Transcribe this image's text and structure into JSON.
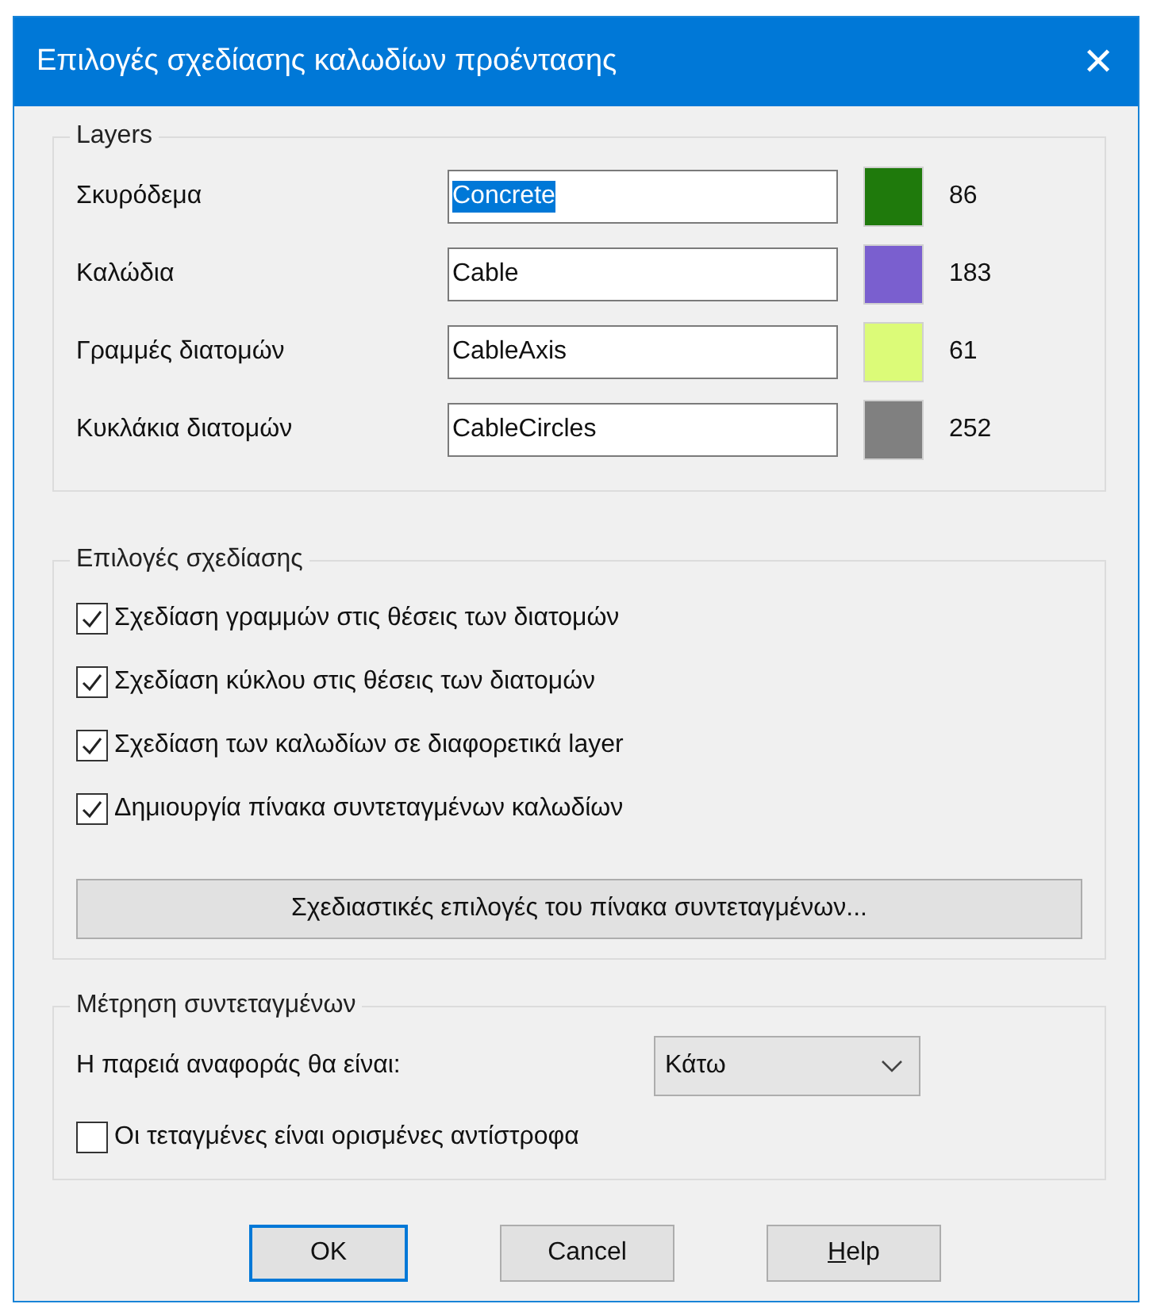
{
  "window": {
    "title": "Επιλογές σχεδίασης καλωδίων προέντασης",
    "close": "✕"
  },
  "layers": {
    "title": "Layers",
    "rows": [
      {
        "label": "Σκυρόδεμα",
        "value": "Concrete",
        "selected": true,
        "color": "#1f7a0c",
        "number": "86"
      },
      {
        "label": "Καλώδια",
        "value": "Cable",
        "selected": false,
        "color": "#7a5fcf",
        "number": "183"
      },
      {
        "label": "Γραμμές διατομών",
        "value": "CableAxis",
        "selected": false,
        "color": "#dcfb78",
        "number": "61"
      },
      {
        "label": "Κυκλάκια διατομών",
        "value": "CableCircles",
        "selected": false,
        "color": "#808080",
        "number": "252"
      }
    ]
  },
  "drawing_options": {
    "title": "Επιλογές σχεδίασης",
    "checkboxes": [
      {
        "label": "Σχεδίαση γραμμών στις θέσεις των διατομών",
        "checked": true
      },
      {
        "label": "Σχεδίαση κύκλου στις θέσεις των διατομών",
        "checked": true
      },
      {
        "label": "Σχεδίαση των καλωδίων σε διαφορετικά layer",
        "checked": true
      },
      {
        "label": "Δημιουργία πίνακα συντεταγμένων καλωδίων",
        "checked": true
      }
    ],
    "button": "Σχεδιαστικές επιλογές του πίνακα συντεταγμένων..."
  },
  "coordinates": {
    "title": "Μέτρηση συντεταγμένων",
    "reference_label": "Η παρειά αναφοράς θα είναι:",
    "reference_value": "Κάτω",
    "checkbox": {
      "label": "Οι τεταγμένες είναι ορισμένες αντίστροφα",
      "checked": false
    }
  },
  "buttons": [
    {
      "label": "OK",
      "default": true
    },
    {
      "label": "Cancel",
      "default": false
    },
    {
      "label": "Help",
      "default": false,
      "underline_first": true
    }
  ]
}
